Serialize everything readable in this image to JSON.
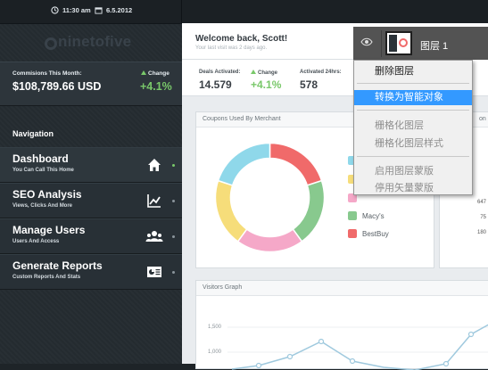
{
  "topbar": {
    "time": "11:30 am",
    "date": "6.5.2012"
  },
  "brand": {
    "logo_text": "ninetofive"
  },
  "commission": {
    "label": "Commisions This Month:",
    "value": "$108,789.66 USD",
    "change_label": "Change",
    "change_value": "+4.1%"
  },
  "navigation": {
    "title": "Navigation",
    "items": [
      {
        "title": "Dashboard",
        "subtitle": "You Can Call This Home",
        "icon": "home-icon"
      },
      {
        "title": "SEO Analysis",
        "subtitle": "Views, Clicks And More",
        "icon": "line-chart-icon"
      },
      {
        "title": "Manage Users",
        "subtitle": "Users And Access",
        "icon": "users-icon"
      },
      {
        "title": "Generate Reports",
        "subtitle": "Custom Reports And Stats",
        "icon": "report-icon"
      }
    ]
  },
  "welcome": {
    "greeting": "Welcome back, Scott!",
    "last_visit": "Your last visit was 2 days ago."
  },
  "stats": [
    {
      "label": "Deals Activated:",
      "value": "14.579",
      "green": false
    },
    {
      "label": "Change",
      "value": "+4.1%",
      "green": true,
      "arrow": true
    },
    {
      "label": "Activated 24hrs:",
      "value": "578",
      "green": false
    }
  ],
  "coupons_panel": {
    "title": "Coupons Used By Merchant",
    "legend": [
      {
        "label": "",
        "color": "#8fd8ea"
      },
      {
        "label": "",
        "color": "#f6dd7a"
      },
      {
        "label": "",
        "color": "#f5a8c8"
      },
      {
        "label": "Macy's",
        "color": "#88c98e"
      },
      {
        "label": "BestBuy",
        "color": "#f06a6a"
      }
    ],
    "donut_colors": [
      "#f06a6a",
      "#88c98e",
      "#f5a8c8",
      "#f6dd7a",
      "#8fd8ea"
    ]
  },
  "right_panel": {
    "title_fragment": "on",
    "values": [
      "647",
      "75",
      "180"
    ]
  },
  "visitors_panel": {
    "title": "Visitors Graph",
    "y_labels": [
      "1,500",
      "1,000"
    ],
    "color": "#9fc9de"
  },
  "ps_context_menu": {
    "layer_name": "图层 1",
    "items": [
      {
        "label": "删除图层",
        "state": "normal"
      },
      {
        "label": "转换为智能对象",
        "state": "highlighted"
      },
      {
        "label": "栅格化图层",
        "state": "disabled"
      },
      {
        "label": "栅格化图层样式",
        "state": "disabled"
      },
      {
        "label": "启用图层蒙版",
        "state": "disabled"
      },
      {
        "label": "停用矢量蒙版",
        "state": "disabled"
      }
    ]
  }
}
